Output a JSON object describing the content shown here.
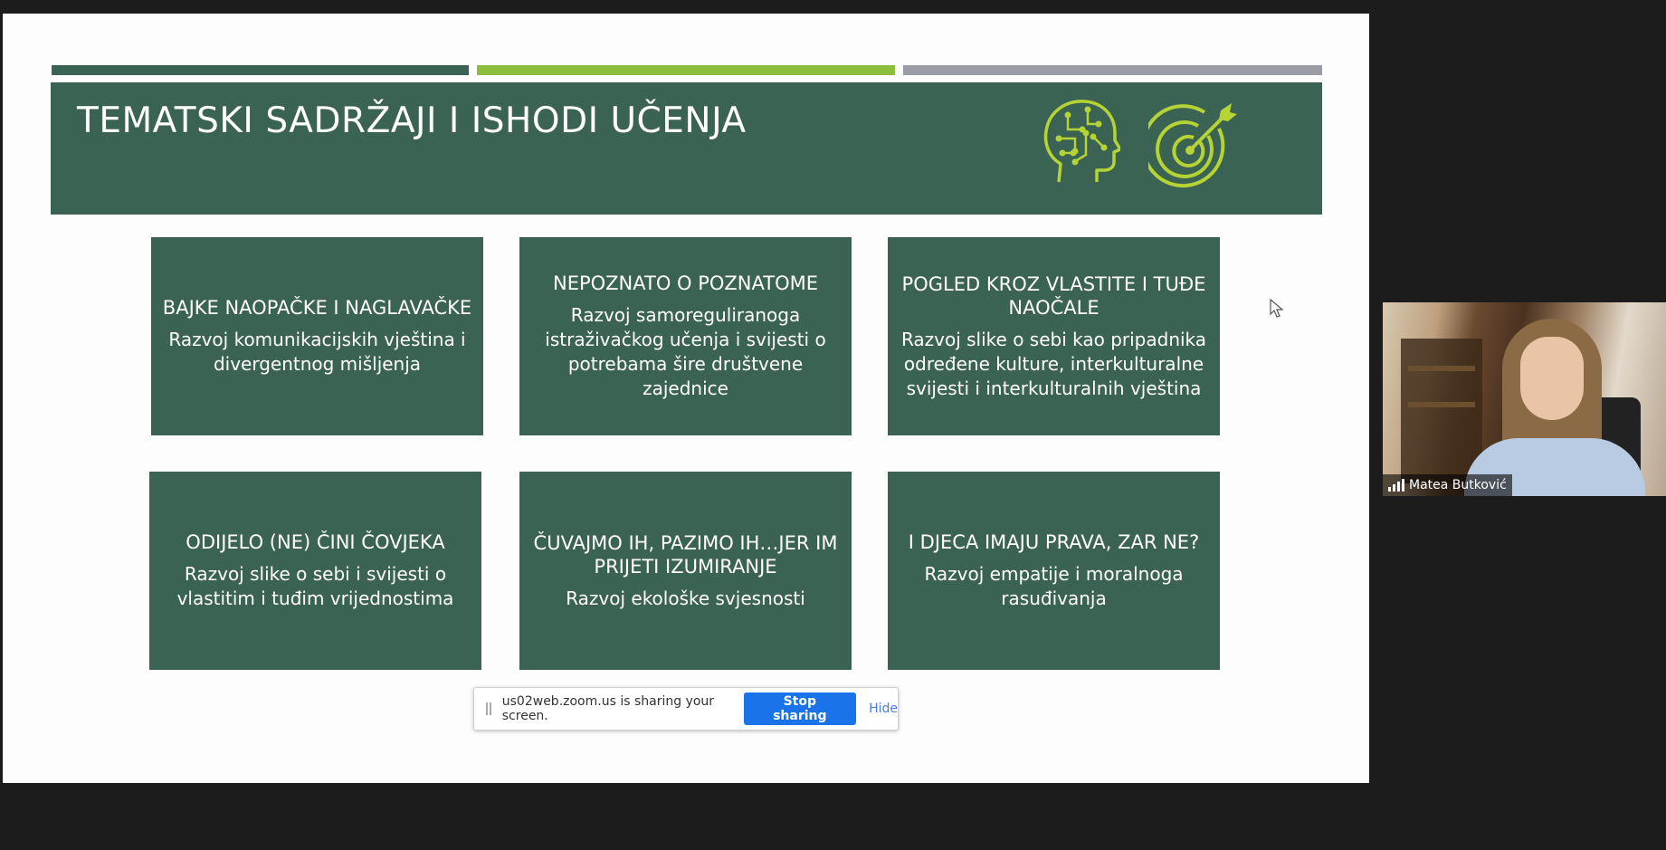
{
  "colors": {
    "slide_green": "#3b6353",
    "accent_lime": "#8cbd3c",
    "accent_gray": "#9a9ea4",
    "icon_lime": "#b5d334",
    "zoom_blue": "#1a73e8",
    "hide_link": "#4a7fd8"
  },
  "slide": {
    "title": "TEMATSKI SADRŽAJI I ISHODI UČENJA",
    "icons": [
      "brain-head-icon",
      "target-arrow-icon"
    ],
    "cards": [
      {
        "title": "BAJKE NAOPAČKE I NAGLAVAČKE",
        "desc": "Razvoj komunikacijskih vještina i divergentnog mišljenja"
      },
      {
        "title": "NEPOZNATO O POZNATOME",
        "desc": "Razvoj samoreguliranoga istraživačkog učenja i svijesti o potrebama šire društvene zajednice"
      },
      {
        "title": "POGLED KROZ VLASTITE I TUĐE NAOČALE",
        "desc": "Razvoj slike o sebi kao pripadnika određene kulture, interkulturalne svijesti i interkulturalnih vještina"
      },
      {
        "title": "ODIJELO (NE) ČINI ČOVJEKA",
        "desc": "Razvoj slike o sebi i svijesti o vlastitim i tuđim vrijednostima"
      },
      {
        "title": "ČUVAJMO IH, PAZIMO IH…JER IM PRIJETI IZUMIRANJE",
        "desc": "Razvoj ekološke svjesnosti"
      },
      {
        "title": "I DJECA IMAJU PRAVA, ZAR NE?",
        "desc": "Razvoj empatije i moralnoga rasuđivanja"
      }
    ]
  },
  "share_bar": {
    "message": "us02web.zoom.us is sharing your screen.",
    "stop_label": "Stop sharing",
    "hide_label": "Hide"
  },
  "participant": {
    "name": "Matea Butković",
    "signal_icon": "signal-strength-icon"
  }
}
